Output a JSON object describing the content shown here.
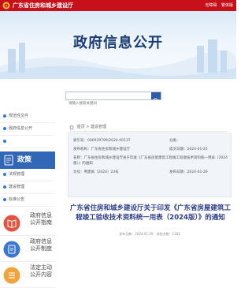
{
  "top_bar": {
    "site_name": "广东省住房和城乡建设厅",
    "tools": [
      "无障碍",
      "繁体版"
    ]
  },
  "banner": {
    "title": "政府信息公开"
  },
  "search": {
    "placeholder": "请输入搜索关键词"
  },
  "sidebar": {
    "links": [
      {
        "label": "规范性文件",
        "dot_color": "#2d7ad6"
      },
      {
        "label": "政府信息公开",
        "dot_color": "#2d7ad6"
      },
      {
        "label": "",
        "dot_color": "#2d7ad6"
      },
      {
        "label": "标准公告",
        "dot_color": "#2d7ad6"
      }
    ],
    "active_card": {
      "label": "政策"
    },
    "small_links": [
      {
        "label": "法规管理",
        "dot_color": "#2d7ad6"
      },
      {
        "label": "建设管理",
        "dot_color": "#2d7ad6"
      },
      {
        "label": "标准公告",
        "dot_color": "#2d7ad6"
      }
    ],
    "big_links": [
      {
        "lines": [
          "政府信息",
          "公开指南"
        ]
      },
      {
        "lines": [
          "政府信息",
          "公开制度"
        ]
      },
      {
        "lines": [
          "法定主动",
          "公开内容"
        ]
      }
    ]
  },
  "breadcrumb": {
    "items": [
      "首页",
      "建设管理"
    ]
  },
  "info": {
    "index_label": "索引号：",
    "index_value": "006939799/2024-00137",
    "category_label": "分类：",
    "publisher_label": "发布机构：",
    "publisher_value": "广东省住房和城乡建设厅",
    "created_label": "成文日期：",
    "created_value": "2024-01-25",
    "name_label": "名称：",
    "name_value": "广东省住房和城乡建设厅关于印发《广东省房屋建筑工程竣工验收技术资料统一用表（2024版）》的通知",
    "doc_no_label": "文号：",
    "doc_no_value": "粤建质〔2024〕23号",
    "pub_date_label": "发布日期：",
    "pub_date_value": "2024-01-29"
  },
  "article": {
    "title": "广东省住房和城乡建设厅关于印发《广东省房屋建筑工程竣工验收技术资料统一用表（2024版）》的通知",
    "meta": "发布日期：2024-01-29　浏览次数：1183"
  },
  "colors": {
    "brand_red": "#c8101a",
    "nav_blue": "#3266b6",
    "title_navy": "#1a3d77"
  }
}
